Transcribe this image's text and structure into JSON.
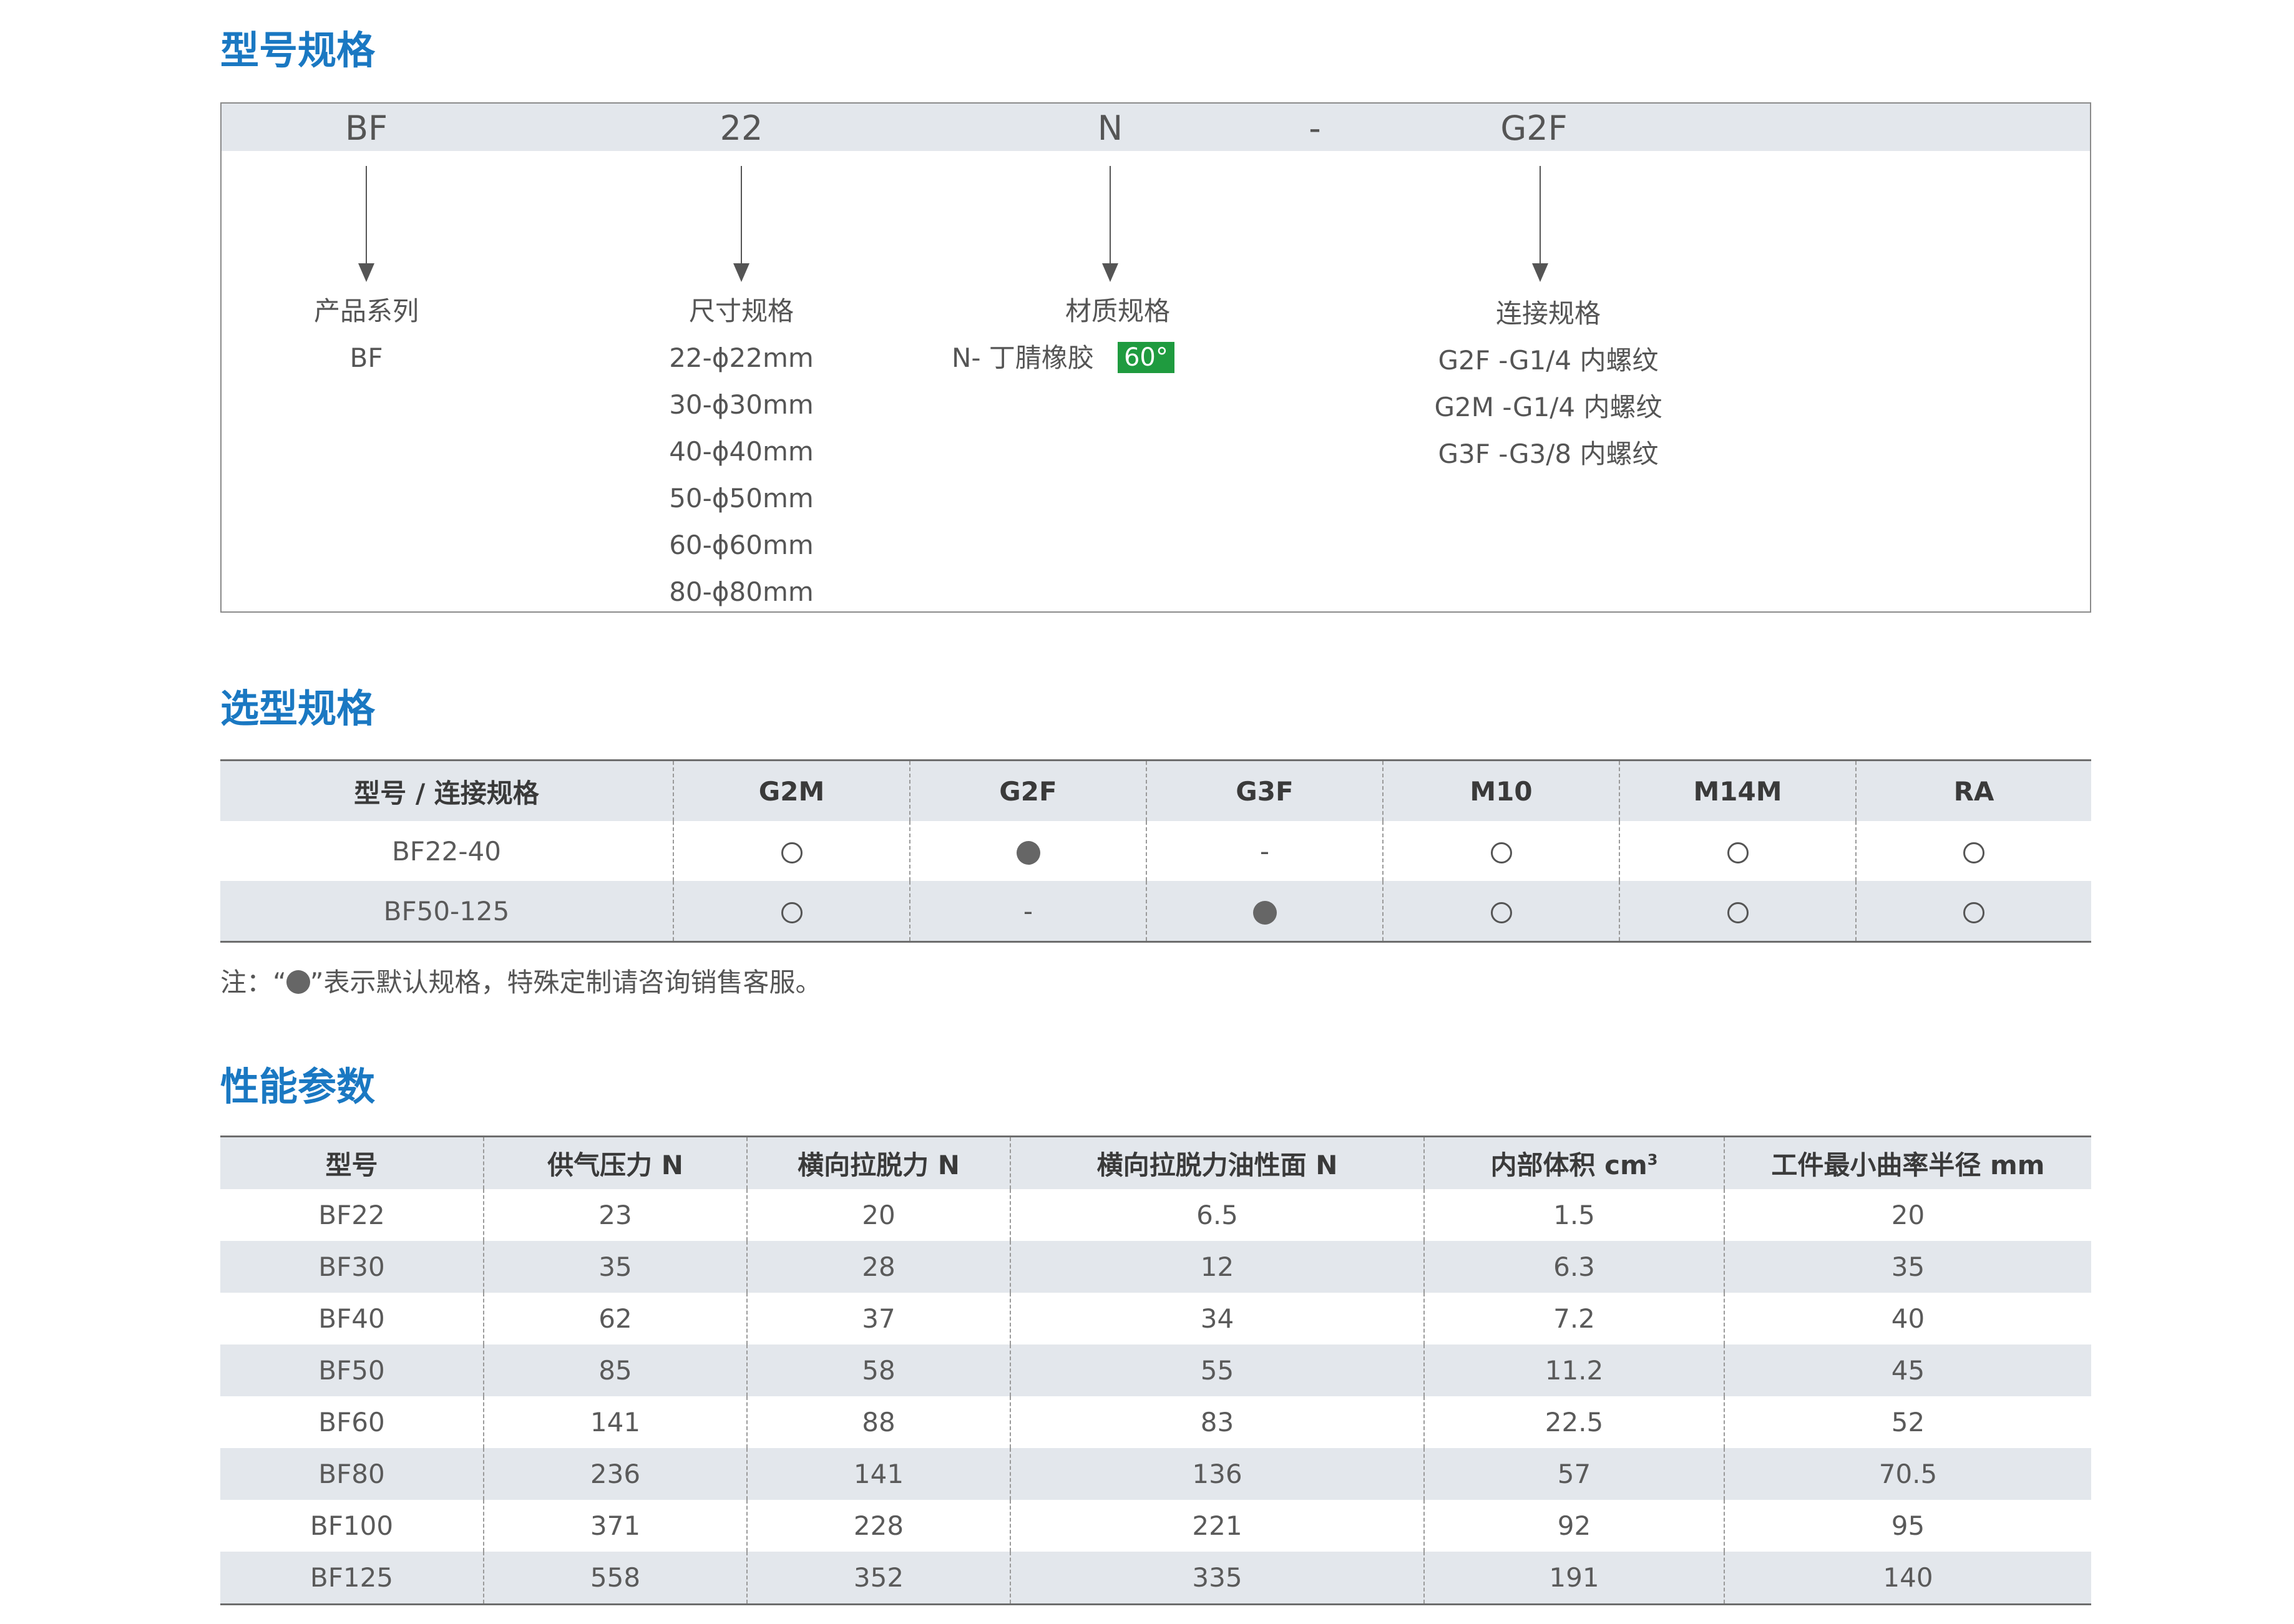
{
  "colors": {
    "title_blue": "#1a78c2",
    "strip_gray": "#e3e7ec",
    "badge_green": "#1f9b3f",
    "text_gray": "#555555"
  },
  "sections": {
    "model_code": "型号规格",
    "selection": "选型规格",
    "performance": "性能参数"
  },
  "model_code": {
    "segments": [
      "BF",
      "22",
      "N",
      "-",
      "G2F"
    ],
    "columns": [
      {
        "title": "产品系列",
        "items": [
          "BF"
        ]
      },
      {
        "title": "尺寸规格",
        "items": [
          "22-ϕ22mm",
          "30-ϕ30mm",
          "40-ϕ40mm",
          "50-ϕ50mm",
          "60-ϕ60mm",
          "80-ϕ80mm"
        ]
      },
      {
        "title": "材质规格",
        "items": [
          "N- 丁腈橡胶"
        ],
        "badge": "60°"
      },
      {
        "title": "连接规格",
        "items": [
          "G2F -G1/4 内螺纹",
          "G2M -G1/4 内螺纹",
          "G3F -G3/8 内螺纹"
        ]
      }
    ]
  },
  "selection_table": {
    "headers": [
      "型号 / 连接规格",
      "G2M",
      "G2F",
      "G3F",
      "M10",
      "M14M",
      "RA"
    ],
    "rows": [
      {
        "model": "BF22-40",
        "marks": [
          "open",
          "filled",
          "-",
          "open",
          "open",
          "open"
        ]
      },
      {
        "model": "BF50-125",
        "marks": [
          "open",
          "-",
          "filled",
          "open",
          "open",
          "open"
        ]
      }
    ],
    "note_prefix": "注：“",
    "note_suffix": "”表示默认规格，特殊定制请咨询销售客服。"
  },
  "performance_table": {
    "headers": [
      "型号",
      "供气压力 N",
      "横向拉脱力 N",
      "横向拉脱力油性面 N",
      "内部体积 cm",
      "工件最小曲率半径 mm"
    ],
    "volume_superscript": "3",
    "rows": [
      [
        "BF22",
        "23",
        "20",
        "6.5",
        "1.5",
        "20"
      ],
      [
        "BF30",
        "35",
        "28",
        "12",
        "6.3",
        "35"
      ],
      [
        "BF40",
        "62",
        "37",
        "34",
        "7.2",
        "40"
      ],
      [
        "BF50",
        "85",
        "58",
        "55",
        "11.2",
        "45"
      ],
      [
        "BF60",
        "141",
        "88",
        "83",
        "22.5",
        "52"
      ],
      [
        "BF80",
        "236",
        "141",
        "136",
        "57",
        "70.5"
      ],
      [
        "BF100",
        "371",
        "228",
        "221",
        "92",
        "95"
      ],
      [
        "BF125",
        "558",
        "352",
        "335",
        "191",
        "140"
      ]
    ]
  }
}
